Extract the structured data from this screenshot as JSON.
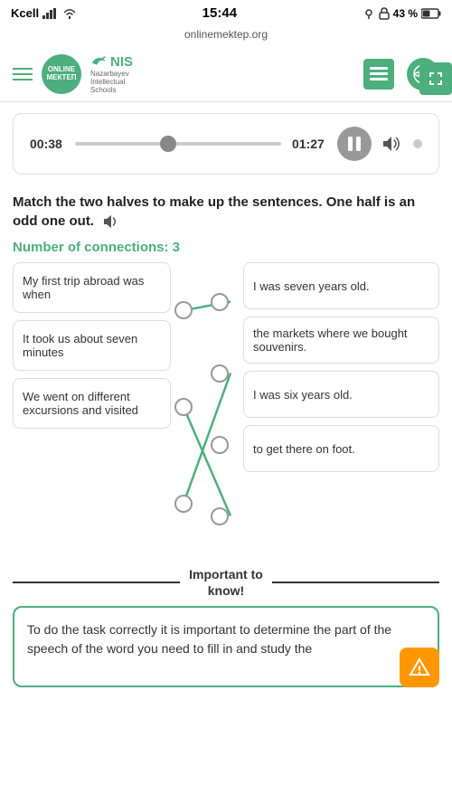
{
  "statusBar": {
    "carrier": "Kcell",
    "time": "15:44",
    "battery": "43 %",
    "url": "onlinemektep.org"
  },
  "topNav": {
    "logoLine1": "ONLINE",
    "logoLine2": "МЕКТЕП",
    "nisTitle": "NIS",
    "nisSub1": "Nazarbayev",
    "nisSub2": "Intellectual",
    "nisSub3": "Schools"
  },
  "audioPlayer": {
    "currentTime": "00:38",
    "totalTime": "01:27",
    "thumbPosition": "45"
  },
  "instructions": {
    "text": "Match the two halves to make up the sentences. One half is an odd one out.",
    "soundLabel": "🔊"
  },
  "connections": {
    "label": "Number of connections: 3"
  },
  "leftCards": [
    {
      "id": "L1",
      "text": "My first trip abroad was when"
    },
    {
      "id": "L2",
      "text": "It took us about seven minutes"
    },
    {
      "id": "L3",
      "text": "We went on different excursions and visited"
    }
  ],
  "rightCards": [
    {
      "id": "R1",
      "text": "I was seven years old."
    },
    {
      "id": "R2",
      "text": "the markets where we bought souvenirs."
    },
    {
      "id": "R3",
      "text": "I was six years old."
    },
    {
      "id": "R4",
      "text": "to get there on foot."
    }
  ],
  "importantSection": {
    "line1": "Important to",
    "line2": "know!"
  },
  "infoCard": {
    "text": "To do the task correctly it is important to determine the part of the speech of the word you need to fill in and study the"
  }
}
